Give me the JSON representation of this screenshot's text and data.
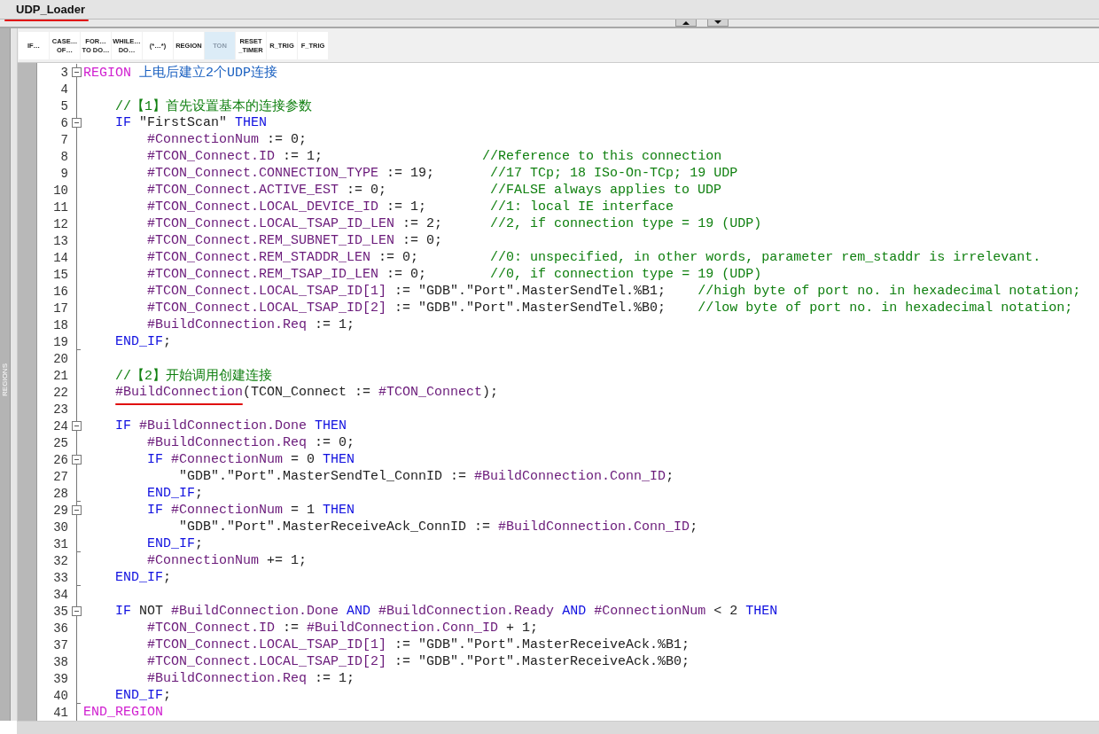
{
  "title": {
    "text": "UDP_Loader",
    "underline": true
  },
  "side_panel": {
    "label": "REGIONS"
  },
  "toolbar": [
    {
      "lines": [
        "IF…"
      ],
      "selected": false
    },
    {
      "lines": [
        "CASE…",
        "OF…"
      ],
      "selected": false
    },
    {
      "lines": [
        "FOR…",
        "TO DO…"
      ],
      "selected": false
    },
    {
      "lines": [
        "WHILE…",
        "DO…"
      ],
      "selected": false
    },
    {
      "lines": [
        "(*…*)"
      ],
      "selected": false
    },
    {
      "lines": [
        "REGION"
      ],
      "selected": false
    },
    {
      "lines": [
        "TON"
      ],
      "selected": true
    },
    {
      "lines": [
        "RESET",
        "_TIMER"
      ],
      "selected": false
    },
    {
      "lines": [
        "R_TRIG"
      ],
      "selected": false
    },
    {
      "lines": [
        "F_TRIG"
      ],
      "selected": false
    }
  ],
  "code_lines": [
    {
      "n": "3",
      "fold_start": true,
      "tokens": [
        {
          "kind": "region",
          "t": "REGION "
        },
        {
          "kind": "name",
          "t": "上电后建立2个UDP连接"
        }
      ]
    },
    {
      "n": "4"
    },
    {
      "n": "5",
      "tokens": [
        {
          "kind": "cmt",
          "t": "    //【1】首先设置基本的连接参数"
        }
      ]
    },
    {
      "n": "6",
      "fold_start": true,
      "tokens": [
        {
          "kind": "kw",
          "t": "    IF "
        },
        {
          "kind": "txt",
          "t": "\"FirstScan\" "
        },
        {
          "kind": "kw",
          "t": "THEN"
        }
      ]
    },
    {
      "n": "7",
      "tokens": [
        {
          "kind": "var",
          "t": "        #ConnectionNum"
        },
        {
          "kind": "txt",
          "t": " := 0;"
        }
      ]
    },
    {
      "n": "8",
      "tokens": [
        {
          "kind": "var",
          "t": "        #TCON_Connect.ID"
        },
        {
          "kind": "txt",
          "t": " := 1;"
        },
        {
          "kind": "cmt",
          "t": "                    //Reference to this connection"
        }
      ]
    },
    {
      "n": "9",
      "tokens": [
        {
          "kind": "var",
          "t": "        #TCON_Connect.CONNECTION_TYPE"
        },
        {
          "kind": "txt",
          "t": " := 19;"
        },
        {
          "kind": "cmt",
          "t": "       //17 TCp; 18 ISo-On-TCp; 19 UDP"
        }
      ]
    },
    {
      "n": "10",
      "tokens": [
        {
          "kind": "var",
          "t": "        #TCON_Connect.ACTIVE_EST"
        },
        {
          "kind": "txt",
          "t": " := 0;"
        },
        {
          "kind": "cmt",
          "t": "             //FALSE always applies to UDP"
        }
      ]
    },
    {
      "n": "11",
      "tokens": [
        {
          "kind": "var",
          "t": "        #TCON_Connect.LOCAL_DEVICE_ID"
        },
        {
          "kind": "txt",
          "t": " := 1;"
        },
        {
          "kind": "cmt",
          "t": "        //1: local IE interface"
        }
      ]
    },
    {
      "n": "12",
      "tokens": [
        {
          "kind": "var",
          "t": "        #TCON_Connect.LOCAL_TSAP_ID_LEN"
        },
        {
          "kind": "txt",
          "t": " := 2;"
        },
        {
          "kind": "cmt",
          "t": "      //2, if connection type = 19 (UDP)"
        }
      ]
    },
    {
      "n": "13",
      "tokens": [
        {
          "kind": "var",
          "t": "        #TCON_Connect.REM_SUBNET_ID_LEN"
        },
        {
          "kind": "txt",
          "t": " := 0;"
        }
      ]
    },
    {
      "n": "14",
      "tokens": [
        {
          "kind": "var",
          "t": "        #TCON_Connect.REM_STADDR_LEN"
        },
        {
          "kind": "txt",
          "t": " := 0;"
        },
        {
          "kind": "cmt",
          "t": "         //0: unspecified, in other words, parameter rem_staddr is irrelevant."
        }
      ]
    },
    {
      "n": "15",
      "tokens": [
        {
          "kind": "var",
          "t": "        #TCON_Connect.REM_TSAP_ID_LEN"
        },
        {
          "kind": "txt",
          "t": " := 0;"
        },
        {
          "kind": "cmt",
          "t": "        //0, if connection type = 19 (UDP)"
        }
      ]
    },
    {
      "n": "16",
      "tokens": [
        {
          "kind": "var",
          "t": "        #TCON_Connect.LOCAL_TSAP_ID[1]"
        },
        {
          "kind": "txt",
          "t": " := \"GDB\".\"Port\".MasterSendTel.%B1;"
        },
        {
          "kind": "cmt",
          "t": "    //high byte of port no. in hexadecimal notation;"
        }
      ]
    },
    {
      "n": "17",
      "tokens": [
        {
          "kind": "var",
          "t": "        #TCON_Connect.LOCAL_TSAP_ID[2]"
        },
        {
          "kind": "txt",
          "t": " := \"GDB\".\"Port\".MasterSendTel.%B0;"
        },
        {
          "kind": "cmt",
          "t": "    //low byte of port no. in hexadecimal notation;"
        }
      ]
    },
    {
      "n": "18",
      "tokens": [
        {
          "kind": "var",
          "t": "        #BuildConnection.Req"
        },
        {
          "kind": "txt",
          "t": " := 1;"
        }
      ]
    },
    {
      "n": "19",
      "fold_end": true,
      "tokens": [
        {
          "kind": "kw",
          "t": "    END_IF"
        },
        {
          "kind": "txt",
          "t": ";"
        }
      ]
    },
    {
      "n": "20"
    },
    {
      "n": "21",
      "tokens": [
        {
          "kind": "cmt",
          "t": "    //【2】开始调用创建连接"
        }
      ]
    },
    {
      "n": "22",
      "tokens": [
        {
          "kind": "var",
          "t": "    #BuildConnection",
          "underline": true
        },
        {
          "kind": "txt",
          "t": "(TCON_Connect := "
        },
        {
          "kind": "var",
          "t": "#TCON_Connect"
        },
        {
          "kind": "txt",
          "t": ");"
        }
      ]
    },
    {
      "n": "23"
    },
    {
      "n": "24",
      "fold_start": true,
      "tokens": [
        {
          "kind": "kw",
          "t": "    IF "
        },
        {
          "kind": "var",
          "t": "#BuildConnection.Done "
        },
        {
          "kind": "kw",
          "t": "THEN"
        }
      ]
    },
    {
      "n": "25",
      "tokens": [
        {
          "kind": "var",
          "t": "        #BuildConnection.Req"
        },
        {
          "kind": "txt",
          "t": " := 0;"
        }
      ]
    },
    {
      "n": "26",
      "fold_start": true,
      "tokens": [
        {
          "kind": "kw",
          "t": "        IF "
        },
        {
          "kind": "var",
          "t": "#ConnectionNum"
        },
        {
          "kind": "txt",
          "t": " = 0 "
        },
        {
          "kind": "kw",
          "t": "THEN"
        }
      ]
    },
    {
      "n": "27",
      "tokens": [
        {
          "kind": "txt",
          "t": "            \"GDB\".\"Port\".MasterSendTel_ConnID := "
        },
        {
          "kind": "var",
          "t": "#BuildConnection.Conn_ID"
        },
        {
          "kind": "txt",
          "t": ";"
        }
      ]
    },
    {
      "n": "28",
      "fold_end": true,
      "tokens": [
        {
          "kind": "kw",
          "t": "        END_IF"
        },
        {
          "kind": "txt",
          "t": ";"
        }
      ]
    },
    {
      "n": "29",
      "fold_start": true,
      "tokens": [
        {
          "kind": "kw",
          "t": "        IF "
        },
        {
          "kind": "var",
          "t": "#ConnectionNum"
        },
        {
          "kind": "txt",
          "t": " = 1 "
        },
        {
          "kind": "kw",
          "t": "THEN"
        }
      ]
    },
    {
      "n": "30",
      "tokens": [
        {
          "kind": "txt",
          "t": "            \"GDB\".\"Port\".MasterReceiveAck_ConnID := "
        },
        {
          "kind": "var",
          "t": "#BuildConnection.Conn_ID"
        },
        {
          "kind": "txt",
          "t": ";"
        }
      ]
    },
    {
      "n": "31",
      "fold_end": true,
      "tokens": [
        {
          "kind": "kw",
          "t": "        END_IF"
        },
        {
          "kind": "txt",
          "t": ";"
        }
      ]
    },
    {
      "n": "32",
      "tokens": [
        {
          "kind": "var",
          "t": "        #ConnectionNum"
        },
        {
          "kind": "txt",
          "t": " += 1;"
        }
      ]
    },
    {
      "n": "33",
      "fold_end": true,
      "tokens": [
        {
          "kind": "kw",
          "t": "    END_IF"
        },
        {
          "kind": "txt",
          "t": ";"
        }
      ]
    },
    {
      "n": "34"
    },
    {
      "n": "35",
      "fold_start": true,
      "tokens": [
        {
          "kind": "kw",
          "t": "    IF "
        },
        {
          "kind": "txt",
          "t": "NOT "
        },
        {
          "kind": "var",
          "t": "#BuildConnection.Done "
        },
        {
          "kind": "kw",
          "t": "AND "
        },
        {
          "kind": "var",
          "t": "#BuildConnection.Ready "
        },
        {
          "kind": "kw",
          "t": "AND "
        },
        {
          "kind": "var",
          "t": "#ConnectionNum"
        },
        {
          "kind": "txt",
          "t": " < 2 "
        },
        {
          "kind": "kw",
          "t": "THEN"
        }
      ]
    },
    {
      "n": "36",
      "tokens": [
        {
          "kind": "var",
          "t": "        #TCON_Connect.ID"
        },
        {
          "kind": "txt",
          "t": " := "
        },
        {
          "kind": "var",
          "t": "#BuildConnection.Conn_ID"
        },
        {
          "kind": "txt",
          "t": " + 1;"
        }
      ]
    },
    {
      "n": "37",
      "tokens": [
        {
          "kind": "var",
          "t": "        #TCON_Connect.LOCAL_TSAP_ID[1]"
        },
        {
          "kind": "txt",
          "t": " := \"GDB\".\"Port\".MasterReceiveAck.%B1;"
        }
      ]
    },
    {
      "n": "38",
      "tokens": [
        {
          "kind": "var",
          "t": "        #TCON_Connect.LOCAL_TSAP_ID[2]"
        },
        {
          "kind": "txt",
          "t": " := \"GDB\".\"Port\".MasterReceiveAck.%B0;"
        }
      ]
    },
    {
      "n": "39",
      "tokens": [
        {
          "kind": "var",
          "t": "        #BuildConnection.Req"
        },
        {
          "kind": "txt",
          "t": " := 1;"
        }
      ]
    },
    {
      "n": "40",
      "fold_end": true,
      "tokens": [
        {
          "kind": "kw",
          "t": "    END_IF"
        },
        {
          "kind": "txt",
          "t": ";"
        }
      ]
    },
    {
      "n": "41",
      "tokens": [
        {
          "kind": "region",
          "t": "END_REGION"
        }
      ]
    }
  ]
}
